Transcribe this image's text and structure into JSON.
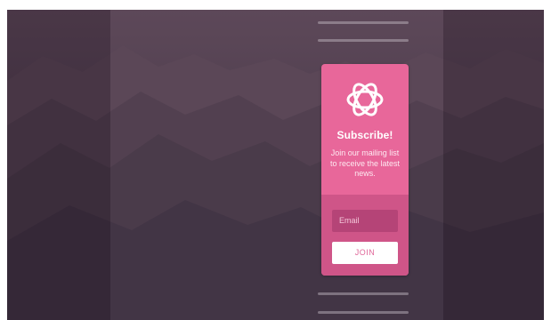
{
  "widget": {
    "title": "Subscribe!",
    "description": "Join our mailing list to receive the latest news.",
    "email_placeholder": "Email",
    "join_label": "JOIN",
    "accent_color": "#e8679a"
  },
  "icons": {
    "logo": "rosette-logo-icon"
  }
}
